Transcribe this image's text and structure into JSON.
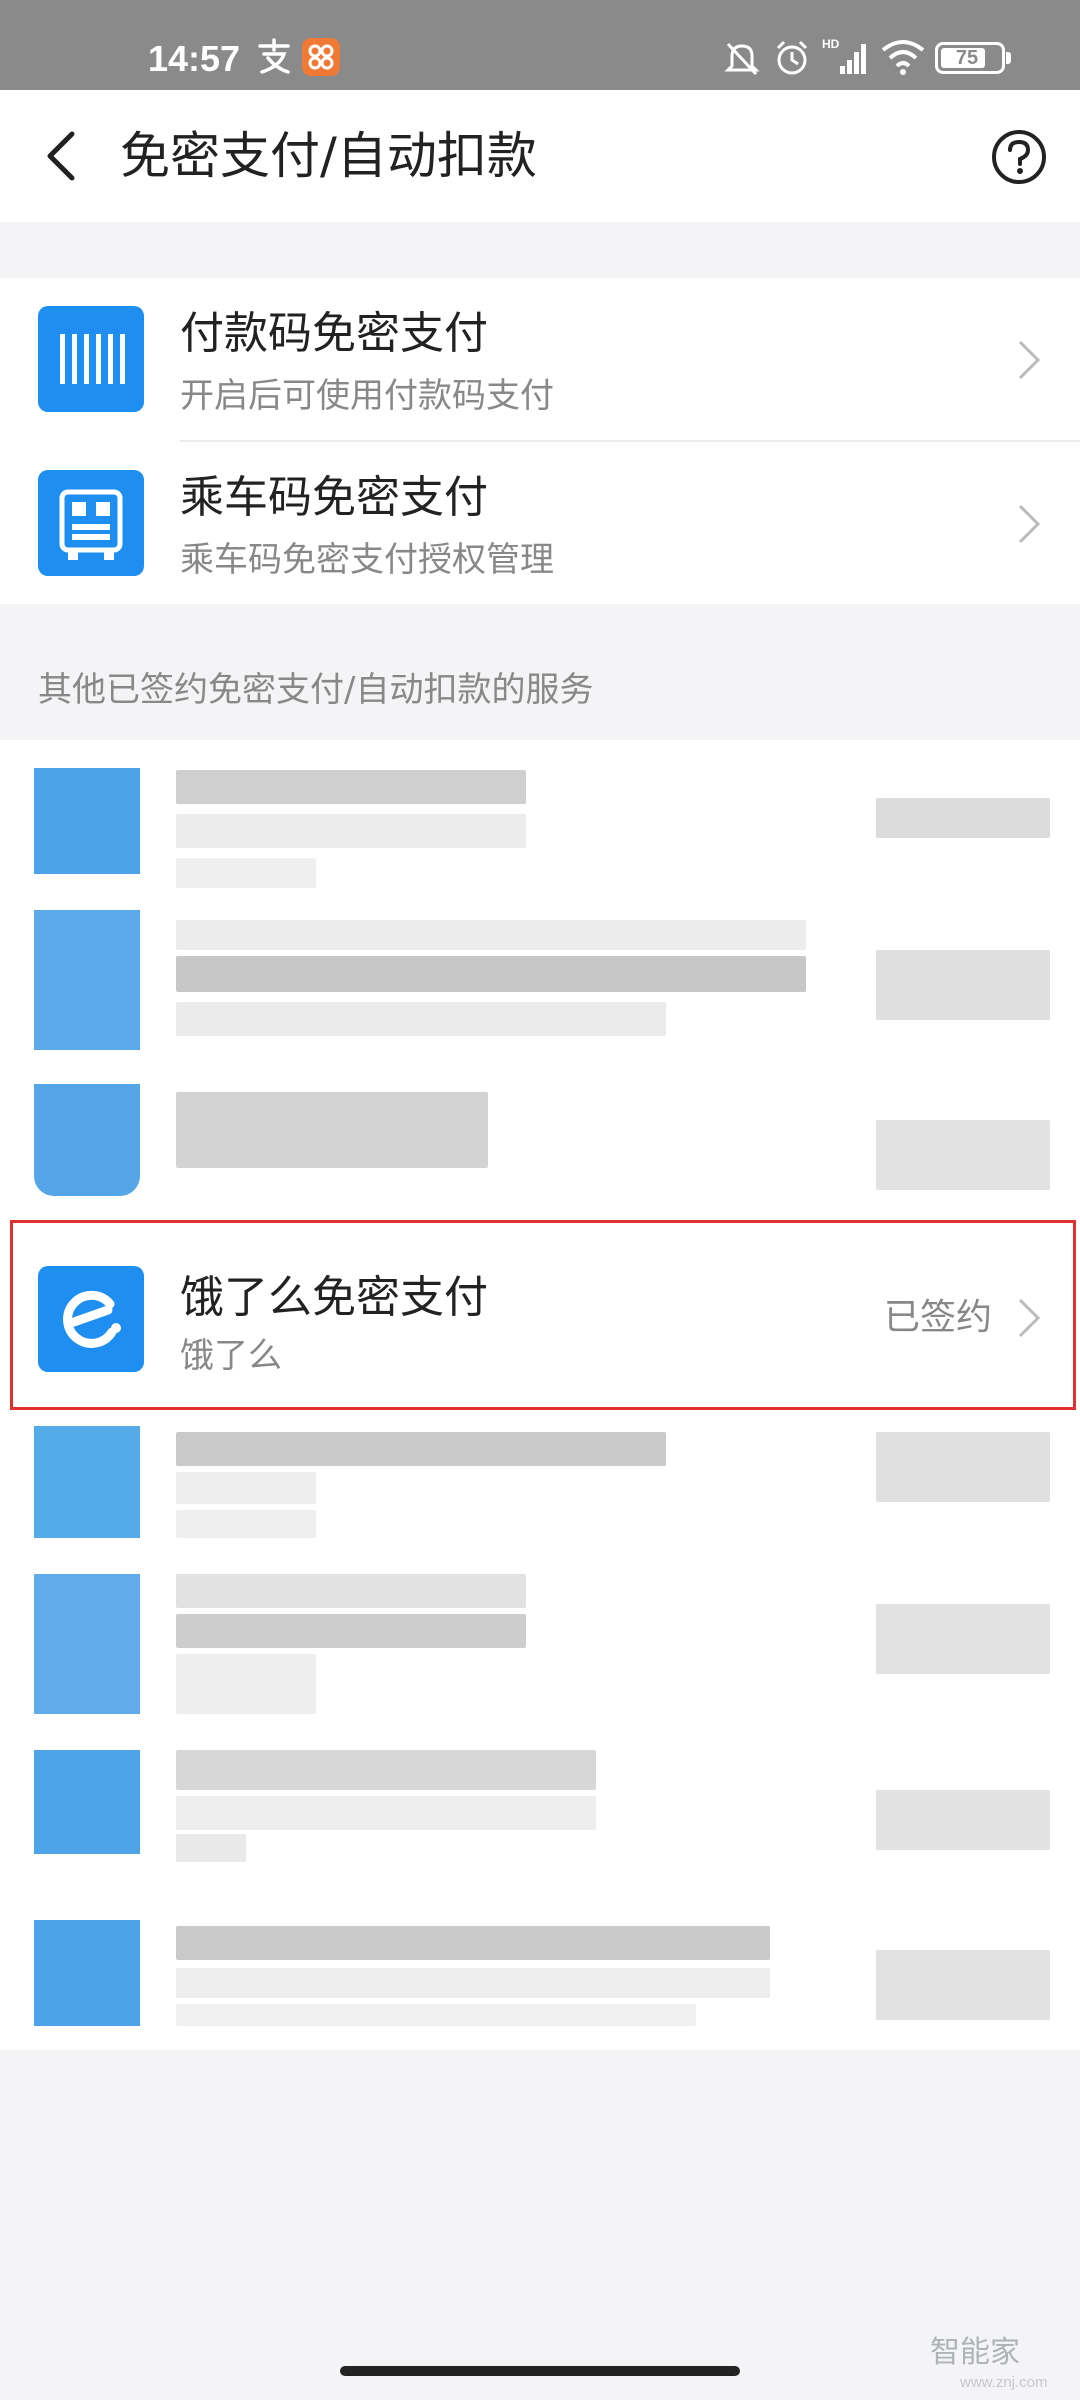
{
  "status_bar": {
    "time": "14:57",
    "battery": "75",
    "icons": [
      "alipay-icon",
      "app-icon",
      "mute-icon",
      "alarm-icon",
      "hd-signal-icon",
      "wifi-icon",
      "battery-icon"
    ]
  },
  "nav": {
    "title": "免密支付/自动扣款",
    "back_icon": "back-arrow-icon",
    "help_icon": "help-icon"
  },
  "top_services": [
    {
      "title": "付款码免密支付",
      "subtitle": "开启后可使用付款码支付",
      "icon": "barcode-icon"
    },
    {
      "title": "乘车码免密支付",
      "subtitle": "乘车码免密支付授权管理",
      "icon": "bus-qr-icon"
    }
  ],
  "section_label": "其他已签约免密支付/自动扣款的服务",
  "highlighted_service": {
    "title": "饿了么免密支付",
    "subtitle": "饿了么",
    "status": "已签约",
    "icon": "eleme-icon"
  },
  "watermark": {
    "text": "智能家",
    "sub": "www.znj.com"
  },
  "colors": {
    "accent": "#1e8ff0",
    "highlight_border": "#e0312f",
    "status_bar_bg": "#8a8a8a"
  }
}
